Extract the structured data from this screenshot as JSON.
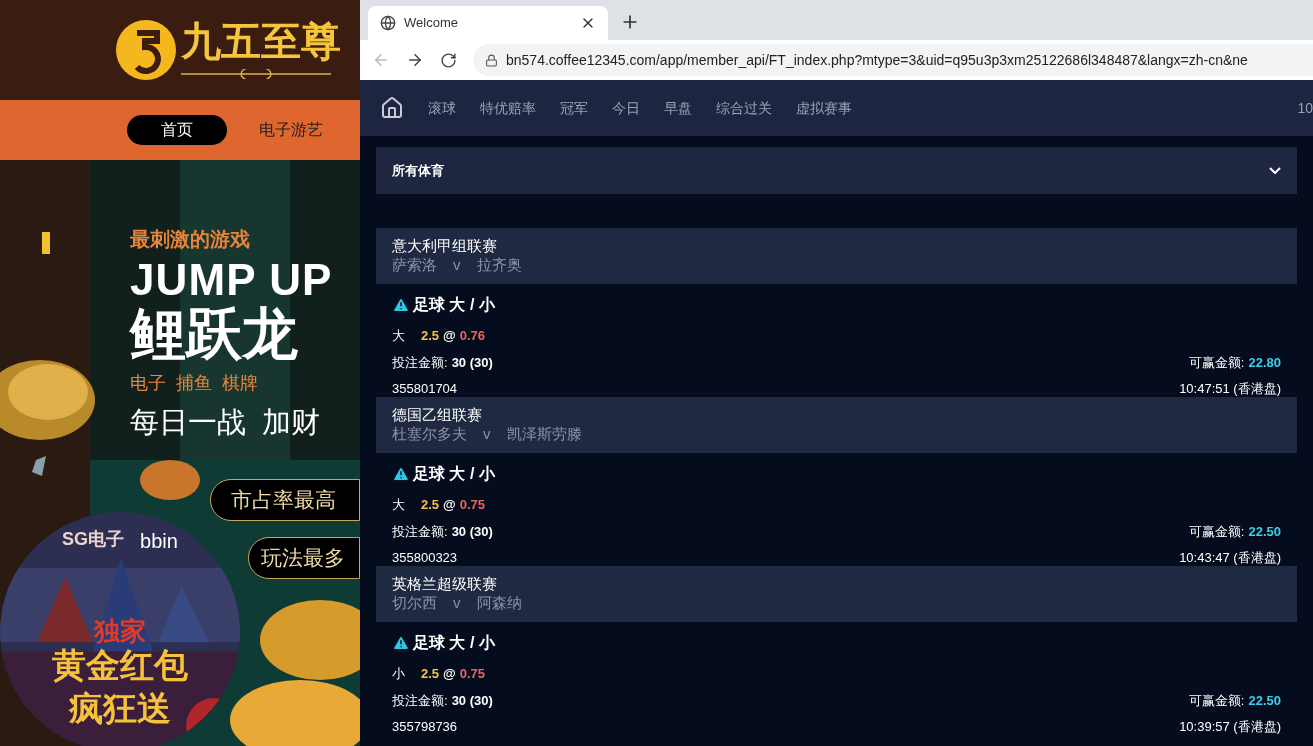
{
  "site": {
    "brand": "九五至尊",
    "nav": [
      {
        "label": "首页",
        "selected": true
      },
      {
        "label": "电子游艺",
        "selected": false
      }
    ],
    "banner": {
      "kicker": "最刺激的游戏",
      "headline": "JUMP UP",
      "title": "鲤跃龙",
      "categories": "电子  捕鱼  棋牌",
      "slogan": "每日一战  加财",
      "buttons": [
        "市占率最高",
        "玩法最多"
      ]
    },
    "promo": {
      "brands": [
        "SG电子",
        "bbin"
      ],
      "tag": "独家",
      "lines": [
        "黄金红包",
        "疯狂送"
      ]
    }
  },
  "browser": {
    "tab": {
      "title": "Welcome"
    },
    "url": "bn574.coffee12345.com/app/member_api/FT_index.php?mtype=3&uid=q95u3p3xm25122686l348487&langx=zh-cn&ne"
  },
  "app": {
    "nav": [
      "滚球",
      "特优赔率",
      "冠军",
      "今日",
      "早盘",
      "综合过关",
      "虚拟赛事"
    ],
    "nav_cut": "10",
    "sport_select": "所有体育",
    "bets": [
      {
        "league": "意大利甲组联赛",
        "home": "萨索洛",
        "vs": "v",
        "away": "拉齐奥",
        "market": "足球 大 / 小",
        "pick": "大",
        "line": "2.5",
        "at": "@",
        "odds": "0.76",
        "stake_label": "投注金额:",
        "stake": "30 (30)",
        "win_label": "可赢金额:",
        "win": "22.80",
        "ticket": "355801704",
        "time": "10:47:51 (香港盘)"
      },
      {
        "league": "德国乙组联赛",
        "home": "杜塞尔多夫",
        "vs": "v",
        "away": "凯泽斯劳滕",
        "market": "足球 大 / 小",
        "pick": "大",
        "line": "2.5",
        "at": "@",
        "odds": "0.75",
        "stake_label": "投注金额:",
        "stake": "30 (30)",
        "win_label": "可赢金额:",
        "win": "22.50",
        "ticket": "355800323",
        "time": "10:43:47 (香港盘)"
      },
      {
        "league": "英格兰超级联赛",
        "home": "切尔西",
        "vs": "v",
        "away": "阿森纳",
        "market": "足球 大 / 小",
        "pick": "小",
        "line": "2.5",
        "at": "@",
        "odds": "0.75",
        "stake_label": "投注金额:",
        "stake": "30 (30)",
        "win_label": "可赢金额:",
        "win": "22.50",
        "ticket": "355798736",
        "time": "10:39:57 (香港盘)"
      }
    ]
  }
}
